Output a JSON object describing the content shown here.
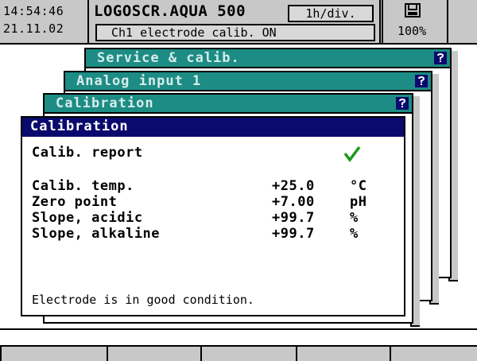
{
  "status_bar": {
    "time": "14:54:46",
    "date": "21.11.02",
    "device_title": "LOGOSCR.AQUA 500",
    "time_scale": "1h/div.",
    "status_message": "Ch1 electrode calib. ON",
    "memory_icon": "memory-card-icon",
    "memory_level": "100%"
  },
  "menu_stack": [
    {
      "title": "Service & calib.",
      "help_icon": "help-icon"
    },
    {
      "title": "Analog input 1",
      "help_icon": "help-icon"
    },
    {
      "title": "Calibration",
      "help_icon": "help-icon"
    }
  ],
  "dialog": {
    "title": "Calibration",
    "report_title": "Calib. report",
    "report_ok_icon": "checkmark-icon",
    "rows": [
      {
        "label": "Calib. temp.",
        "value": "+25.0",
        "unit": "°C"
      },
      {
        "label": "Zero point",
        "value": "+7.00",
        "unit": "pH"
      },
      {
        "label": "Slope, acidic",
        "value": "+99.7",
        "unit": "%"
      },
      {
        "label": "Slope, alkaline",
        "value": "+99.7",
        "unit": "%"
      }
    ],
    "condition_message": "Electrode is in good condition."
  },
  "softkeys": [
    "",
    "",
    "",
    "",
    ""
  ],
  "colors": {
    "menu_header": "#1c8c84",
    "dialog_header": "#0a0a6e",
    "check": "#1a9a1a",
    "bar": "#c8c8c8"
  }
}
